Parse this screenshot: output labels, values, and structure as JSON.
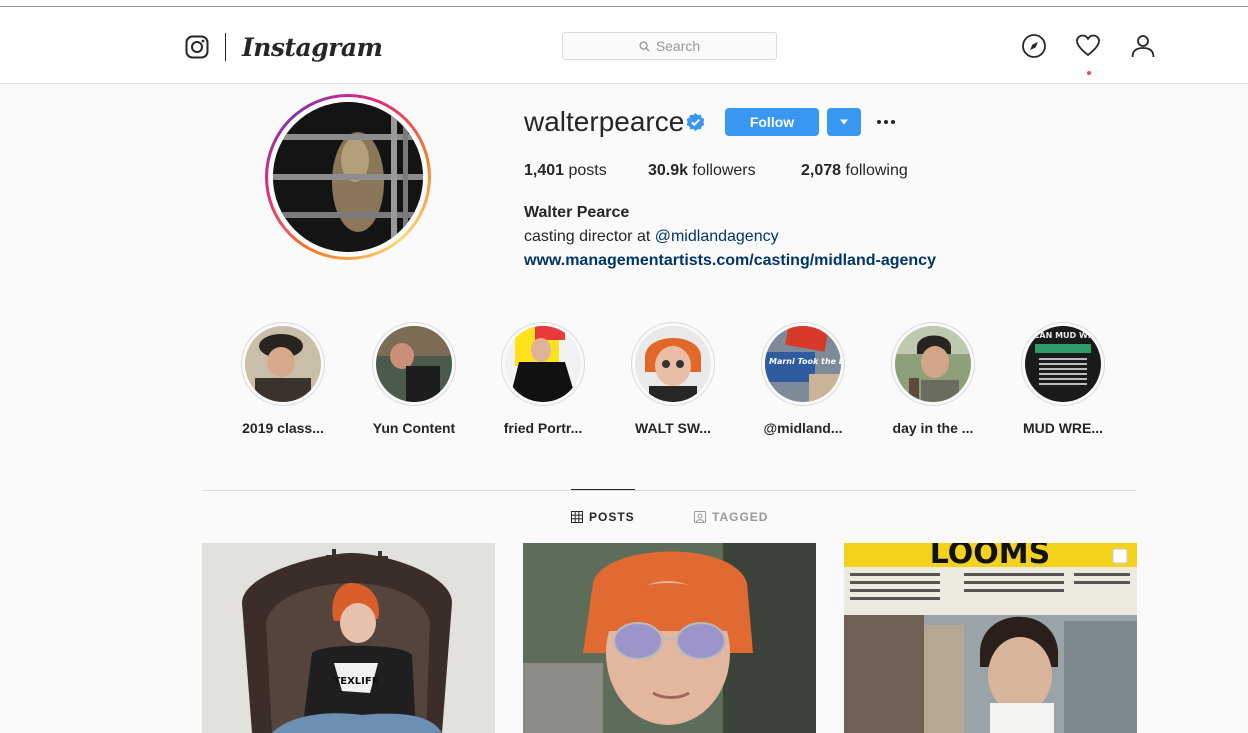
{
  "colors": {
    "accent": "#3897f0",
    "link": "#003569",
    "text": "#262626",
    "muted": "#999999",
    "notification": "#ed4956"
  },
  "header": {
    "logo_icon": "instagram-camera-icon",
    "wordmark": "Instagram",
    "search_placeholder": "Search",
    "icons": [
      "compass-icon",
      "heart-icon",
      "user-icon"
    ]
  },
  "profile": {
    "username": "walterpearce",
    "verified": true,
    "follow_label": "Follow",
    "stats": {
      "posts": "1,401",
      "posts_label": "posts",
      "followers": "30.9k",
      "followers_label": "followers",
      "following": "2,078",
      "following_label": "following"
    },
    "full_name": "Walter Pearce",
    "bio_text": "casting director at ",
    "bio_mention": "@midlandagency",
    "website": "www.managementartists.com/casting/midland-agency"
  },
  "highlights": [
    {
      "label": "2019 class..."
    },
    {
      "label": "Yun Content"
    },
    {
      "label": "fried Portr..."
    },
    {
      "label": "WALT SW..."
    },
    {
      "label": "@midland..."
    },
    {
      "label": "day in the ..."
    },
    {
      "label": "MUD WRE..."
    }
  ],
  "highlight_image_text": {
    "midland": "Marni Took the Lead",
    "mud": "AMERICAN MUD WRESTLE"
  },
  "tabs": [
    {
      "label": "POSTS",
      "active": true
    },
    {
      "label": "TAGGED",
      "active": false
    }
  ],
  "posts": [
    {
      "shirt_text": "TEXLIFE"
    },
    {},
    {
      "magazine_title": "LOOMS"
    }
  ]
}
